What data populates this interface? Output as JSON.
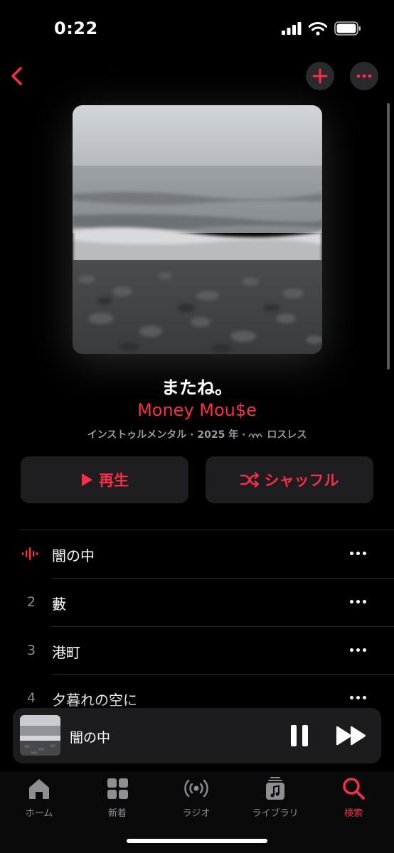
{
  "status": {
    "time": "0:22"
  },
  "album": {
    "title": "またね。",
    "artist": "Money Mou$e",
    "meta_genre_year": "インストゥルメンタル · 2025 年 · ",
    "meta_lossless": "ロスレス"
  },
  "buttons": {
    "play": "再生",
    "shuffle": "シャッフル"
  },
  "tracks": [
    {
      "number": "",
      "name": "闇の中",
      "playing": true
    },
    {
      "number": "2",
      "name": "藪"
    },
    {
      "number": "3",
      "name": "港町"
    },
    {
      "number": "4",
      "name": "夕暮れの空に"
    }
  ],
  "mini_player": {
    "title": "闇の中"
  },
  "tabs": [
    {
      "label": "ホーム",
      "icon": "house-icon"
    },
    {
      "label": "新着",
      "icon": "grid-icon"
    },
    {
      "label": "ラジオ",
      "icon": "radio-icon"
    },
    {
      "label": "ライブラリ",
      "icon": "library-icon"
    },
    {
      "label": "検索",
      "icon": "search-icon",
      "active": true
    }
  ],
  "colors": {
    "accent": "#fa2d48",
    "background": "#000000",
    "button_bg": "#1e1e20"
  }
}
